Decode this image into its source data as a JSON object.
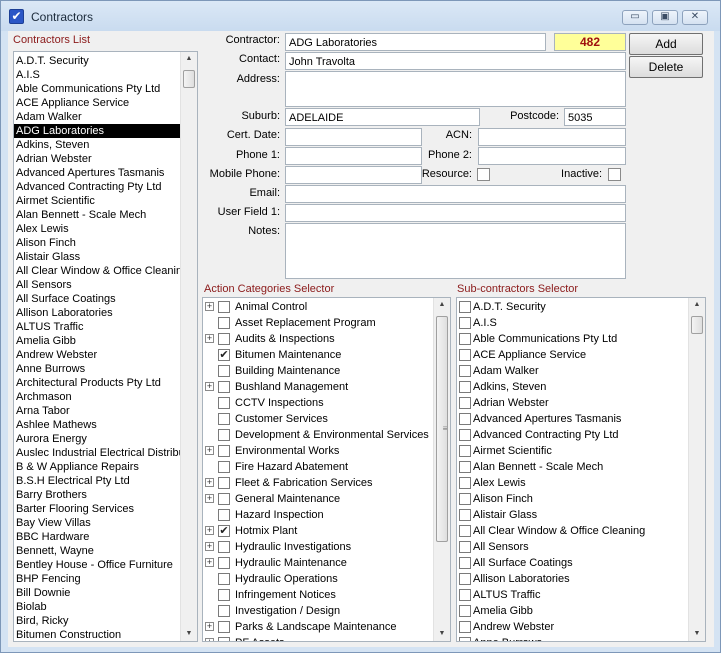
{
  "window": {
    "title": "Contractors",
    "minimize_glyph": "▭",
    "maximize_glyph": "▣",
    "close_glyph": "✕"
  },
  "contractors_list": {
    "header": "Contractors List",
    "selected": "ADG Laboratories",
    "items": [
      "A.D.T. Security",
      "A.I.S",
      "Able Communications Pty Ltd",
      "ACE Appliance Service",
      "Adam Walker",
      "ADG Laboratories",
      "Adkins, Steven",
      "Adrian Webster",
      "Advanced Apertures Tasmanis",
      "Advanced Contracting Pty Ltd",
      "Airmet Scientific",
      "Alan Bennett - Scale Mech",
      "Alex Lewis",
      "Alison Finch",
      "Alistair Glass",
      "All Clear Window & Office Cleaning",
      "All Sensors",
      "All Surface Coatings",
      "Allison Laboratories",
      "ALTUS Traffic",
      "Amelia Gibb",
      "Andrew Webster",
      "Anne Burrows",
      "Architectural Products Pty Ltd",
      "Archmason",
      "Arna Tabor",
      "Ashlee Mathews",
      "Aurora Energy",
      "Auslec Industrial Electrical Distribut",
      "B & W Appliance Repairs",
      "B.S.H Electrical Pty Ltd",
      "Barry Brothers",
      "Barter Flooring Services",
      "Bay View Villas",
      "BBC Hardware",
      "Bennett, Wayne",
      "Bentley House - Office Furniture",
      "BHP Fencing",
      "Bill Downie",
      "Biolab",
      "Bird, Ricky",
      "Bitumen Construction"
    ]
  },
  "form": {
    "contractor_label": "Contractor:",
    "contractor_value": "ADG Laboratories",
    "contractor_id": "482",
    "contact_label": "Contact:",
    "contact_value": "John Travolta",
    "address_label": "Address:",
    "address_value": "",
    "suburb_label": "Suburb:",
    "suburb_value": "ADELAIDE",
    "postcode_label": "Postcode:",
    "postcode_value": "5035",
    "cert_date_label": "Cert. Date:",
    "cert_date_value": "",
    "acn_label": "ACN:",
    "acn_value": "",
    "phone1_label": "Phone 1:",
    "phone1_value": "",
    "phone2_label": "Phone 2:",
    "phone2_value": "",
    "mobile_label": "Mobile Phone:",
    "mobile_value": "",
    "resource_label": "Resource:",
    "resource_checked": false,
    "inactive_label": "Inactive:",
    "inactive_checked": false,
    "email_label": "Email:",
    "email_value": "",
    "userfield1_label": "User Field 1:",
    "userfield1_value": "",
    "notes_label": "Notes:",
    "notes_value": ""
  },
  "buttons": {
    "add": "Add",
    "delete": "Delete"
  },
  "action_categories": {
    "header": "Action Categories Selector",
    "items": [
      {
        "label": "Animal Control",
        "expandable": true,
        "checked": false
      },
      {
        "label": "Asset Replacement Program",
        "expandable": false,
        "checked": false
      },
      {
        "label": "Audits & Inspections",
        "expandable": true,
        "checked": false
      },
      {
        "label": "Bitumen Maintenance",
        "expandable": false,
        "checked": true
      },
      {
        "label": "Building Maintenance",
        "expandable": false,
        "checked": false
      },
      {
        "label": "Bushland Management",
        "expandable": true,
        "checked": false
      },
      {
        "label": "CCTV Inspections",
        "expandable": false,
        "checked": false
      },
      {
        "label": "Customer Services",
        "expandable": false,
        "checked": false
      },
      {
        "label": "Development & Environmental Services",
        "expandable": false,
        "checked": false
      },
      {
        "label": "Environmental Works",
        "expandable": true,
        "checked": false
      },
      {
        "label": "Fire Hazard Abatement",
        "expandable": false,
        "checked": false
      },
      {
        "label": "Fleet & Fabrication Services",
        "expandable": true,
        "checked": false
      },
      {
        "label": "General Maintenance",
        "expandable": true,
        "checked": false
      },
      {
        "label": "Hazard Inspection",
        "expandable": false,
        "checked": false
      },
      {
        "label": "Hotmix Plant",
        "expandable": true,
        "checked": true
      },
      {
        "label": "Hydraulic Investigations",
        "expandable": true,
        "checked": false
      },
      {
        "label": "Hydraulic Maintenance",
        "expandable": true,
        "checked": false
      },
      {
        "label": "Hydraulic Operations",
        "expandable": false,
        "checked": false
      },
      {
        "label": "Infringement Notices",
        "expandable": false,
        "checked": false
      },
      {
        "label": "Investigation / Design",
        "expandable": false,
        "checked": false
      },
      {
        "label": "Parks & Landscape Maintenance",
        "expandable": true,
        "checked": false
      },
      {
        "label": "PF Assets",
        "expandable": true,
        "checked": false
      }
    ]
  },
  "subcontractors": {
    "header": "Sub-contractors Selector",
    "items": [
      "A.D.T. Security",
      "A.I.S",
      "Able Communications Pty Ltd",
      "ACE Appliance Service",
      "Adam Walker",
      "Adkins, Steven",
      "Adrian Webster",
      "Advanced Apertures Tasmanis",
      "Advanced Contracting Pty Ltd",
      "Airmet Scientific",
      "Alan Bennett - Scale Mech",
      "Alex Lewis",
      "Alison Finch",
      "Alistair Glass",
      "All Clear Window & Office Cleaning",
      "All Sensors",
      "All Surface Coatings",
      "Allison Laboratories",
      "ALTUS Traffic",
      "Amelia Gibb",
      "Andrew Webster",
      "Anne Burrows"
    ]
  },
  "icons": {
    "check_glyph": "✔",
    "plus_glyph": "+",
    "up_arrow": "▲",
    "down_arrow": "▼"
  }
}
